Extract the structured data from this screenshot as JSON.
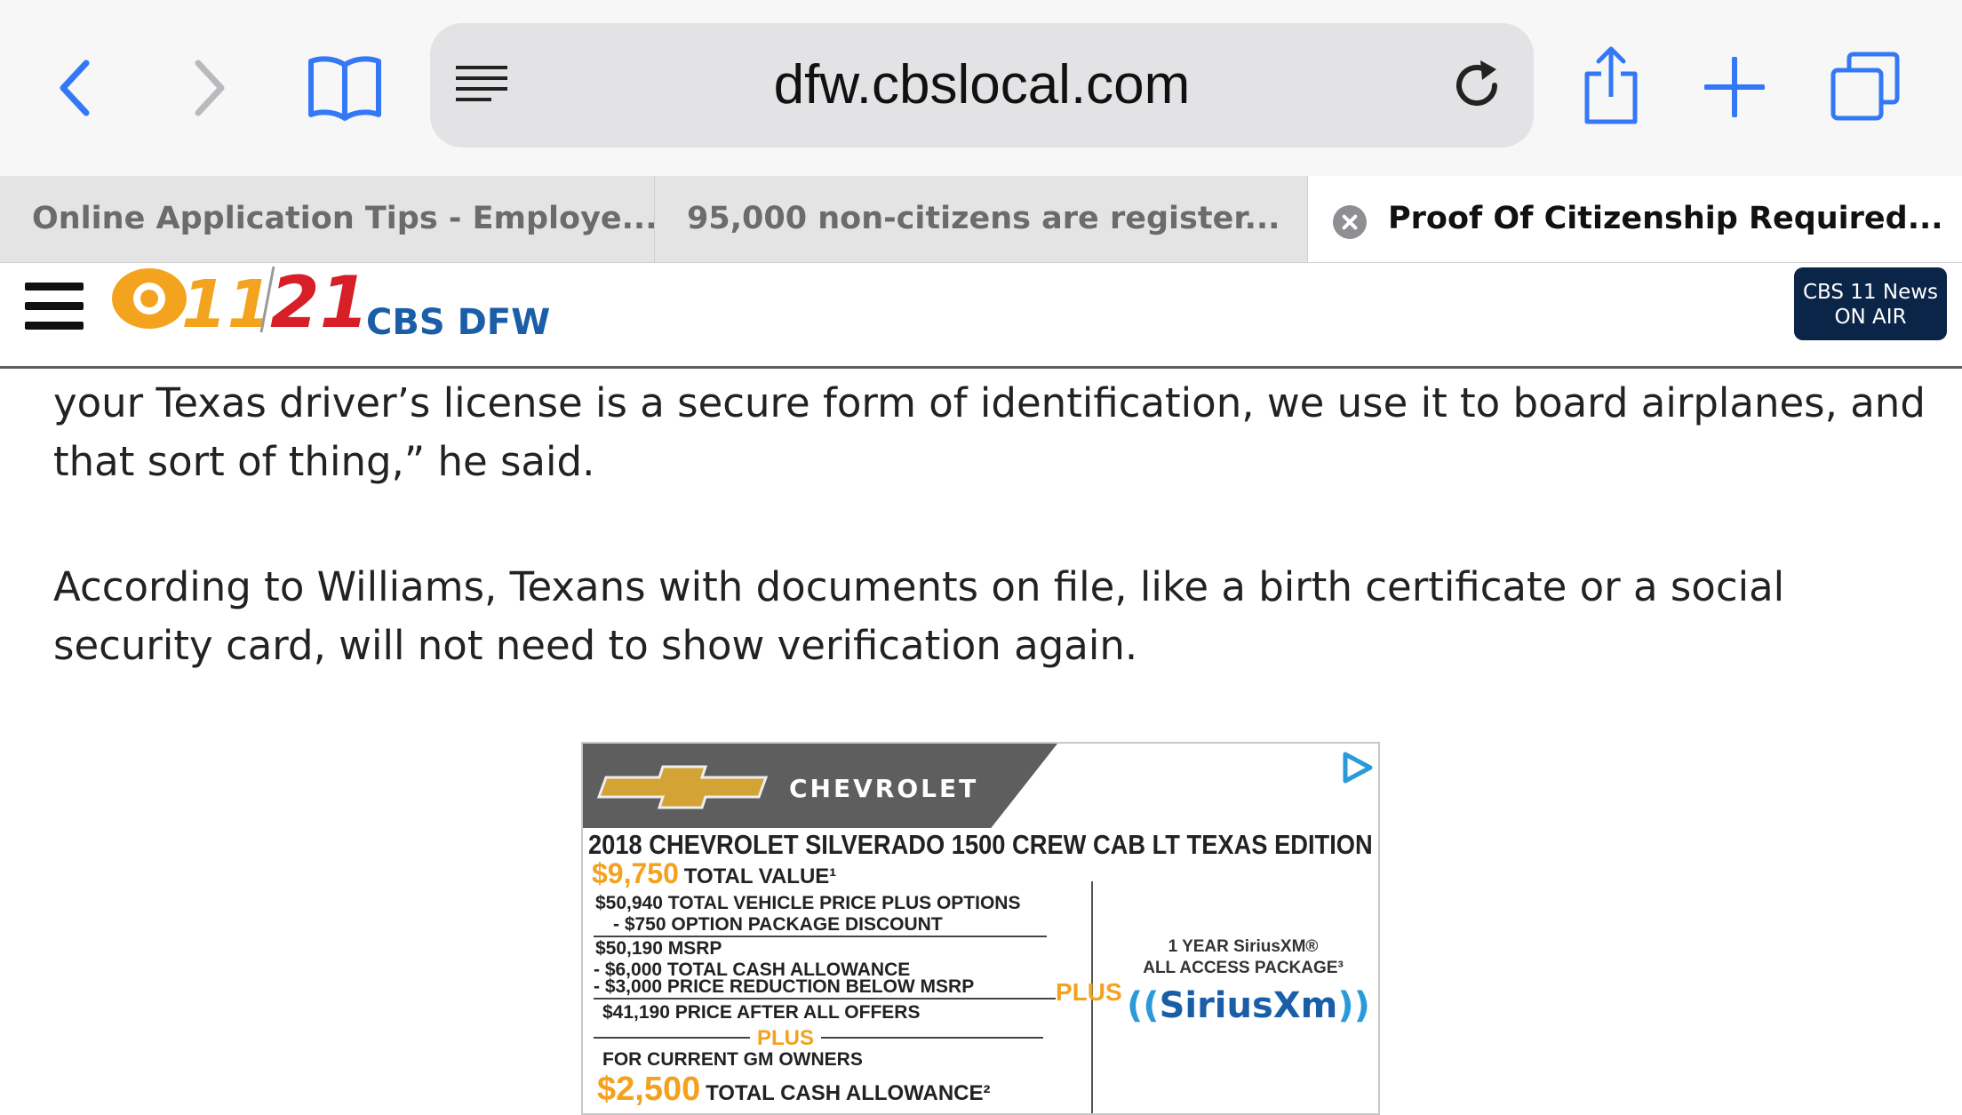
{
  "browser": {
    "url": "dfw.cbslocal.com",
    "icons": {
      "back": "chevron-left-icon",
      "forward": "chevron-right-icon",
      "bookmarks": "book-icon",
      "reader": "reader-lines-icon",
      "reload": "reload-icon",
      "share": "share-icon",
      "new_tab": "plus-icon",
      "tabs": "tabs-icon"
    },
    "accent_color": "#3478f6"
  },
  "tabs": [
    {
      "label": "Online Application Tips - Employe...",
      "active": false
    },
    {
      "label": "95,000 non-citizens are register...",
      "active": false
    },
    {
      "label": "Proof Of Citizenship Required...",
      "active": true
    }
  ],
  "site": {
    "brand": "CBS DFW",
    "logo_numbers": {
      "left": "11",
      "right": "21"
    },
    "on_air": {
      "line1": "CBS 11 News",
      "line2": "ON AIR"
    }
  },
  "article": {
    "paragraphs": [
      "your Texas driver’s license is a secure form of identification, we use it to board airplanes, and that sort of thing,” he said.",
      "According to Williams, Texans with documents on file, like a birth certificate or a social security card, will not need to show verification again."
    ]
  },
  "ad": {
    "brand": "CHEVROLET",
    "headline": "2018 CHEVROLET SILVERADO 1500 CREW CAB LT TEXAS EDITION",
    "total_value_amount": "$9,750",
    "total_value_label": "TOTAL VALUE¹",
    "lines": [
      "$50,940 TOTAL VEHICLE PRICE PLUS OPTIONS",
      "- $750 OPTION PACKAGE DISCOUNT",
      "$50,190 MSRP",
      "- $6,000 TOTAL CASH ALLOWANCE",
      "- $3,000 PRICE REDUCTION BELOW MSRP",
      "$41,190 PRICE AFTER ALL OFFERS"
    ],
    "plus": "PLUS",
    "gm_owners": "FOR CURRENT GM OWNERS",
    "cash_amount": "$2,500",
    "cash_label": "TOTAL CASH ALLOWANCE²",
    "side_plus": "PLUS",
    "sirius_line1": "1 YEAR SiriusXM®",
    "sirius_line2": "ALL ACCESS PACKAGE³",
    "sirius_logo": "SiriusXm",
    "adchoices_icon": "adchoices-icon"
  }
}
